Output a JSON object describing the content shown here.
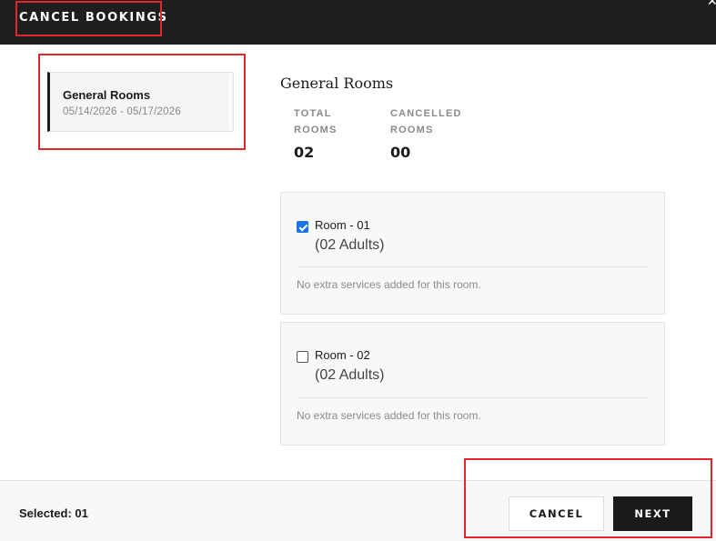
{
  "header": {
    "title": "CANCEL BOOKINGS",
    "close_icon": "close-icon"
  },
  "sidebar": {
    "room_type": {
      "name": "General Rooms",
      "dates": "05/14/2026 - 05/17/2026"
    }
  },
  "main": {
    "title": "General Rooms",
    "stats": {
      "total_label": "TOTAL ROOMS",
      "total_value": "02",
      "cancelled_label": "CANCELLED ROOMS",
      "cancelled_value": "00"
    },
    "rooms": [
      {
        "name": "Room - 01",
        "guests": "(02 Adults)",
        "checked": true,
        "note": "No extra services added for this room."
      },
      {
        "name": "Room - 02",
        "guests": "(02 Adults)",
        "checked": false,
        "note": "No extra services added for this room."
      }
    ]
  },
  "footer": {
    "selected": "Selected: 01",
    "cancel_label": "CANCEL",
    "next_label": "NEXT"
  },
  "colors": {
    "header_bg": "#1e1e1e",
    "highlight": "#e3262b",
    "checkbox_accent": "#1a73e8",
    "primary_button": "#1a1a1a"
  }
}
